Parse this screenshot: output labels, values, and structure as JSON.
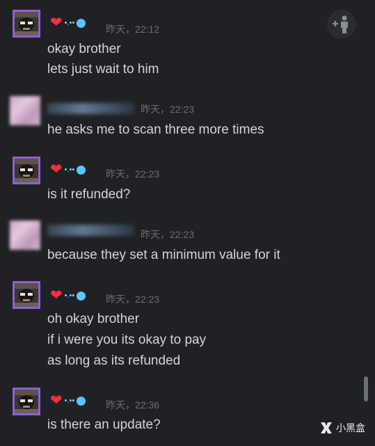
{
  "messages": [
    {
      "sender": "me",
      "time": "昨天，22:12",
      "lines": [
        "okay brother",
        "lets just wait to him"
      ]
    },
    {
      "sender": "other",
      "time": "昨天，22:23",
      "lines": [
        "he asks me to scan three more times"
      ]
    },
    {
      "sender": "me",
      "time": "昨天，22:23",
      "lines": [
        "is it refunded?"
      ]
    },
    {
      "sender": "other",
      "time": "昨天，22:23",
      "lines": [
        "because they set a minimum value for it"
      ]
    },
    {
      "sender": "me",
      "time": "昨天，22:23",
      "lines": [
        "oh okay brother",
        "if i were you its okay to pay",
        "as long as its refunded"
      ]
    },
    {
      "sender": "me",
      "time": "昨天，22:36",
      "lines": [
        "is there an update?"
      ]
    }
  ],
  "my_name": {
    "heart": "❤",
    "dots": "•.••"
  },
  "watermark": {
    "text": "小黑盒"
  },
  "colors": {
    "background": "#202124",
    "avatar_border": "#8f5fd6",
    "heart": "#ff2a3a",
    "status_dot": "#56c8ff"
  },
  "icons": {
    "add_friend": "add-friend-icon",
    "watermark": "xiaoheihe-logo-icon"
  }
}
